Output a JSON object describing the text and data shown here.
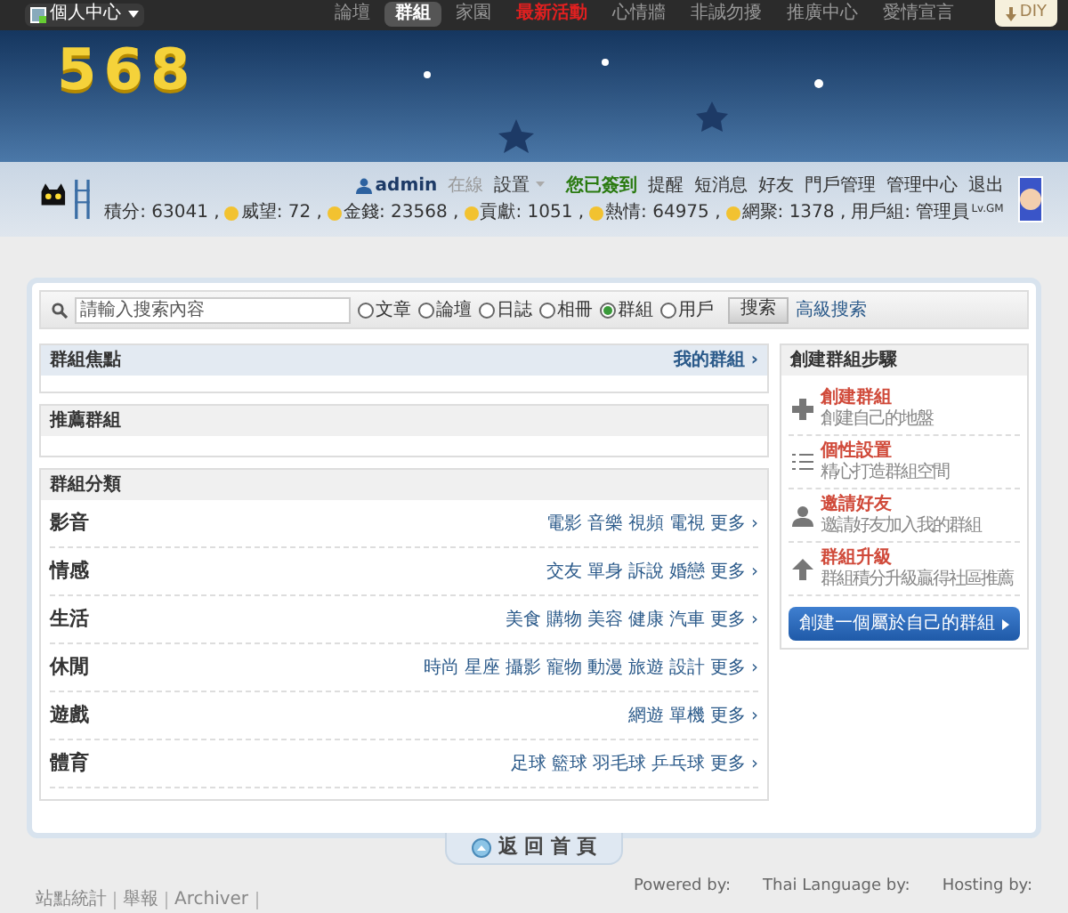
{
  "topbar": {
    "personal_menu": "個人中心",
    "nav": [
      {
        "label": "論壇",
        "selected": false,
        "highlight": false
      },
      {
        "label": "群組",
        "selected": true,
        "highlight": false
      },
      {
        "label": "家園",
        "selected": false,
        "highlight": false
      },
      {
        "label": "最新活動",
        "selected": false,
        "highlight": true
      },
      {
        "label": "心情牆",
        "selected": false,
        "highlight": false
      },
      {
        "label": "非誠勿擾",
        "selected": false,
        "highlight": false
      },
      {
        "label": "推廣中心",
        "selected": false,
        "highlight": false
      },
      {
        "label": "愛情宣言",
        "selected": false,
        "highlight": false
      }
    ],
    "diy": "DIY"
  },
  "banner": {
    "logo": "568"
  },
  "userbar": {
    "username": "admin",
    "status": "在線",
    "links": [
      {
        "label": "設置",
        "kind": "dropdown"
      },
      {
        "label": "您已簽到",
        "kind": "signed"
      },
      {
        "label": "提醒",
        "kind": "link"
      },
      {
        "label": "短消息",
        "kind": "link"
      },
      {
        "label": "好友",
        "kind": "link"
      },
      {
        "label": "門戶管理",
        "kind": "link"
      },
      {
        "label": "管理中心",
        "kind": "link"
      },
      {
        "label": "退出",
        "kind": "link"
      }
    ],
    "stats": [
      {
        "label": "積分: 63041 ,",
        "icon": false
      },
      {
        "label": "威望: 72 ,",
        "icon": true
      },
      {
        "label": "金錢: 23568 ,",
        "icon": true
      },
      {
        "label": "貢獻: 1051 ,",
        "icon": true
      },
      {
        "label": "熱情: 64975 ,",
        "icon": true
      },
      {
        "label": "網聚: 1378 ,",
        "icon": true
      },
      {
        "label": "用戶組: 管理員",
        "icon": false
      }
    ],
    "level": "Lv.GM"
  },
  "search": {
    "placeholder": "請輸入搜索內容",
    "options": [
      {
        "label": "文章",
        "selected": false
      },
      {
        "label": "論壇",
        "selected": false
      },
      {
        "label": "日誌",
        "selected": false
      },
      {
        "label": "相冊",
        "selected": false
      },
      {
        "label": "群組",
        "selected": true
      },
      {
        "label": "用戶",
        "selected": false
      }
    ],
    "button": "搜索",
    "advanced": "高級搜索"
  },
  "focus": {
    "title": "群組焦點",
    "link": "我的群組 ›"
  },
  "recommended": {
    "title": "推薦群組"
  },
  "categories": {
    "title": "群組分類",
    "rows": [
      {
        "name": "影音",
        "tags": [
          "電影",
          "音樂",
          "視頻",
          "電視"
        ],
        "more": "更多 ›"
      },
      {
        "name": "情感",
        "tags": [
          "交友",
          "單身",
          "訴說",
          "婚戀"
        ],
        "more": "更多 ›"
      },
      {
        "name": "生活",
        "tags": [
          "美食",
          "購物",
          "美容",
          "健康",
          "汽車"
        ],
        "more": "更多 ›"
      },
      {
        "name": "休閒",
        "tags": [
          "時尚",
          "星座",
          "攝影",
          "寵物",
          "動漫",
          "旅遊",
          "設計"
        ],
        "more": "更多 ›"
      },
      {
        "name": "遊戲",
        "tags": [
          "網遊",
          "單機"
        ],
        "more": "更多 ›"
      },
      {
        "name": "體育",
        "tags": [
          "足球",
          "籃球",
          "羽毛球",
          "乒乓球"
        ],
        "more": "更多 ›"
      }
    ]
  },
  "steps": {
    "title": "創建群組步驟",
    "items": [
      {
        "kind": "plus",
        "title": "創建群組",
        "text": "創建自己的地盤"
      },
      {
        "kind": "list",
        "title": "個性設置",
        "text": "精心打造群組空間"
      },
      {
        "kind": "person",
        "title": "邀請好友",
        "text": "邀請好友加入我的群組"
      },
      {
        "kind": "up",
        "title": "群組升級",
        "text": "群組積分升級贏得社區推薦"
      }
    ],
    "button": "創建一個屬於自己的群組"
  },
  "back_home": "返 回 首 頁",
  "footer": {
    "links": [
      "站點統計",
      "舉報",
      "Archiver"
    ],
    "credits": [
      "Powered by:",
      "Thai Language by:",
      "Hosting by:"
    ]
  }
}
